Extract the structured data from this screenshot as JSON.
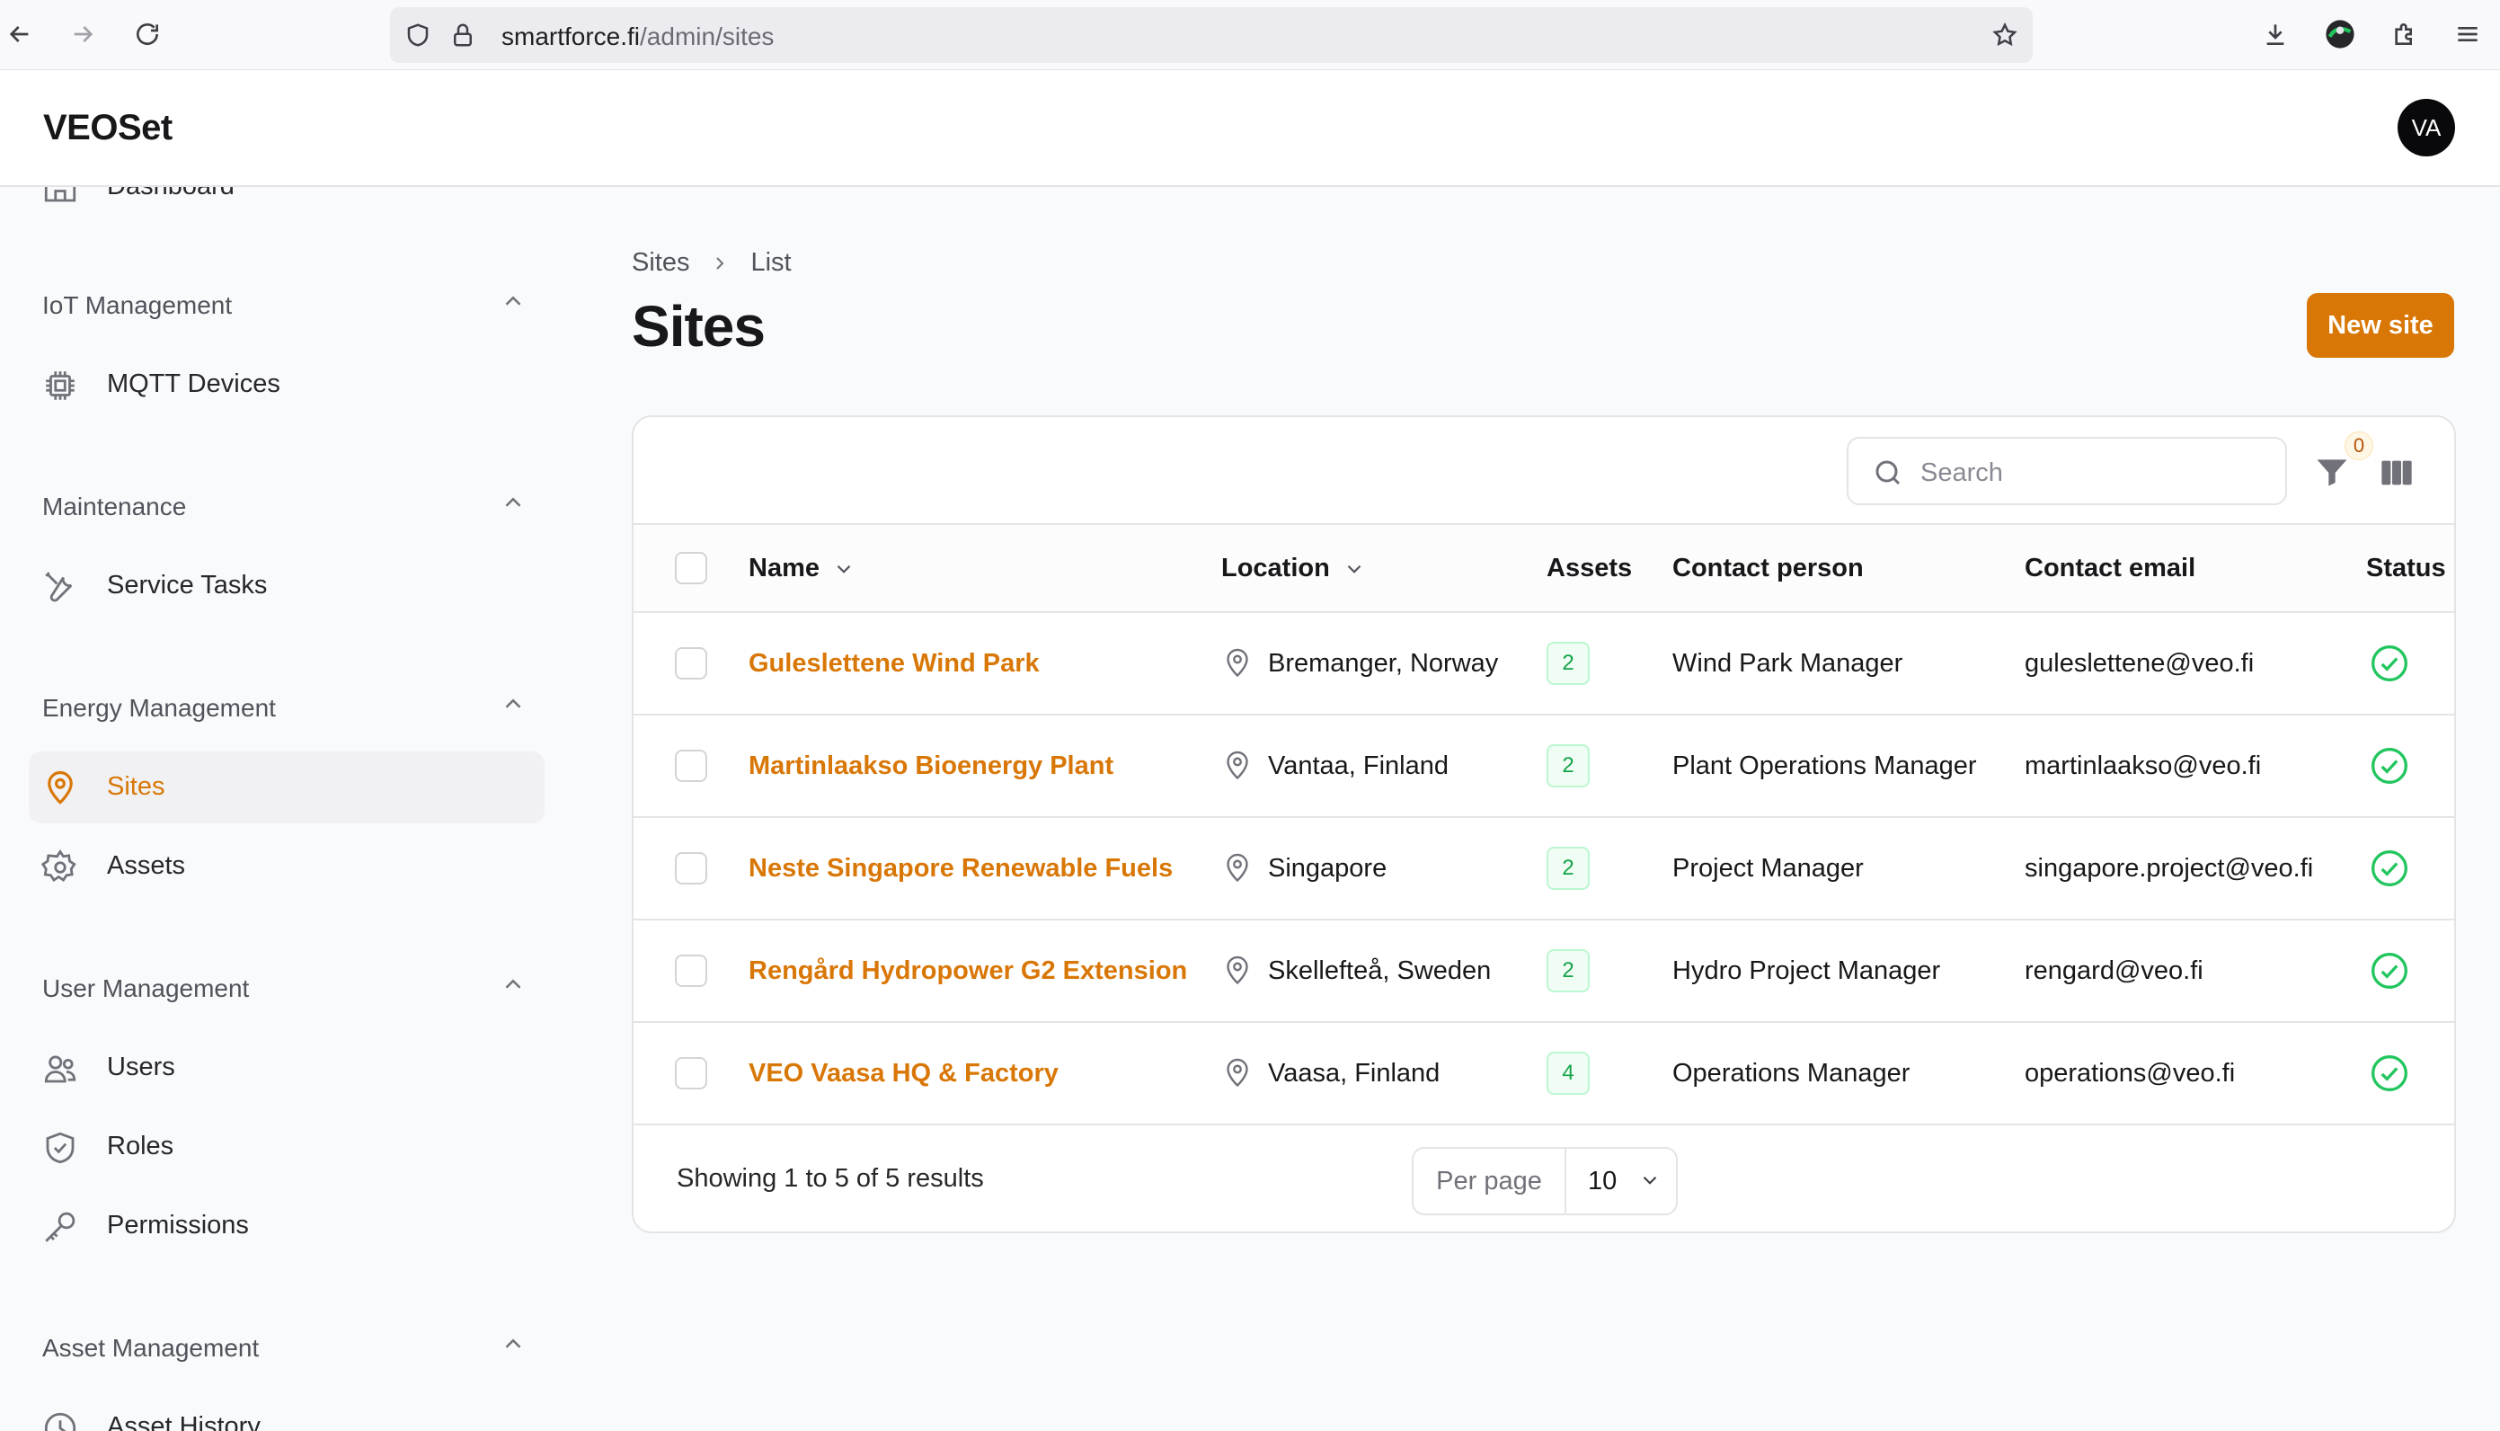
{
  "browser": {
    "url_host": "smartforce.fi",
    "url_path": "/admin/sites"
  },
  "app": {
    "brand": "VEOSet",
    "avatar_initials": "VA",
    "accent_color": "#d97706"
  },
  "sidebar": {
    "top_partial": {
      "label": "Dashboard",
      "icon": "home-icon"
    },
    "groups": [
      {
        "label": "IoT Management",
        "items": [
          {
            "label": "MQTT Devices",
            "icon": "chip-icon"
          }
        ]
      },
      {
        "label": "Maintenance",
        "items": [
          {
            "label": "Service Tasks",
            "icon": "wrench-screwdriver-icon"
          }
        ]
      },
      {
        "label": "Energy Management",
        "items": [
          {
            "label": "Sites",
            "icon": "map-pin-icon",
            "active": true
          },
          {
            "label": "Assets",
            "icon": "gear-icon"
          }
        ]
      },
      {
        "label": "User Management",
        "items": [
          {
            "label": "Users",
            "icon": "users-icon"
          },
          {
            "label": "Roles",
            "icon": "shield-check-icon"
          },
          {
            "label": "Permissions",
            "icon": "key-icon"
          }
        ]
      },
      {
        "label": "Asset Management",
        "items": [
          {
            "label": "Asset History",
            "icon": "clock-icon"
          }
        ]
      }
    ]
  },
  "breadcrumb": {
    "parent": "Sites",
    "current": "List"
  },
  "page": {
    "title": "Sites",
    "new_button": "New site"
  },
  "table": {
    "search_placeholder": "Search",
    "filter_count": "0",
    "columns": {
      "name": "Name",
      "location": "Location",
      "assets": "Assets",
      "contact_person": "Contact person",
      "contact_email": "Contact email",
      "status": "Status"
    },
    "rows": [
      {
        "name": "Guleslettene Wind Park",
        "location": "Bremanger, Norway",
        "assets": "2",
        "contact_person": "Wind Park Manager",
        "contact_email": "guleslettene@veo.fi",
        "status": "active"
      },
      {
        "name": "Martinlaakso Bioenergy Plant",
        "location": "Vantaa, Finland",
        "assets": "2",
        "contact_person": "Plant Operations Manager",
        "contact_email": "martinlaakso@veo.fi",
        "status": "active"
      },
      {
        "name": "Neste Singapore Renewable Fuels",
        "location": "Singapore",
        "assets": "2",
        "contact_person": "Project Manager",
        "contact_email": "singapore.project@veo.fi",
        "status": "active"
      },
      {
        "name": "Rengård Hydropower G2 Extension",
        "location": "Skellefteå, Sweden",
        "assets": "2",
        "contact_person": "Hydro Project Manager",
        "contact_email": "rengard@veo.fi",
        "status": "active"
      },
      {
        "name": "VEO Vaasa HQ & Factory",
        "location": "Vaasa, Finland",
        "assets": "4",
        "contact_person": "Operations Manager",
        "contact_email": "operations@veo.fi",
        "status": "active"
      }
    ],
    "footer": {
      "summary": "Showing 1 to 5 of 5 results",
      "per_page_label": "Per page",
      "per_page_value": "10"
    }
  }
}
